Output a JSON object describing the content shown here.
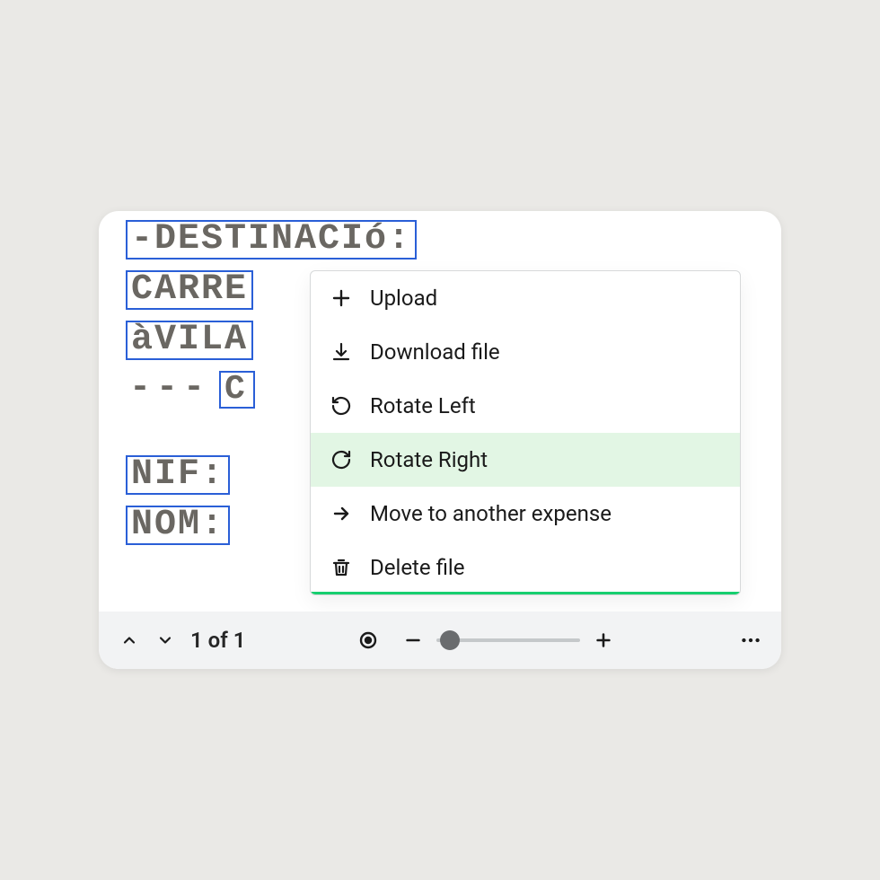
{
  "document": {
    "lines": [
      {
        "boxes": [
          "-DESTINACIó:"
        ]
      },
      {
        "boxes": [
          "CARRE",
          "…"
        ]
      },
      {
        "boxes": [
          "àVILA",
          "…"
        ]
      },
      {
        "dashes": "--- ",
        "boxes": [
          "C"
        ]
      }
    ],
    "fields": [
      "NIF:",
      "NOM:"
    ]
  },
  "toolbar": {
    "page_label": "1 of 1"
  },
  "menu": {
    "items": [
      {
        "icon": "plus-icon",
        "label": "Upload",
        "highlighted": false
      },
      {
        "icon": "download-icon",
        "label": "Download file",
        "highlighted": false
      },
      {
        "icon": "rotate-left-icon",
        "label": "Rotate Left",
        "highlighted": false
      },
      {
        "icon": "rotate-right-icon",
        "label": "Rotate Right",
        "highlighted": true
      },
      {
        "icon": "move-icon",
        "label": "Move to another expense",
        "highlighted": false
      },
      {
        "icon": "trash-icon",
        "label": "Delete file",
        "highlighted": false
      }
    ]
  }
}
